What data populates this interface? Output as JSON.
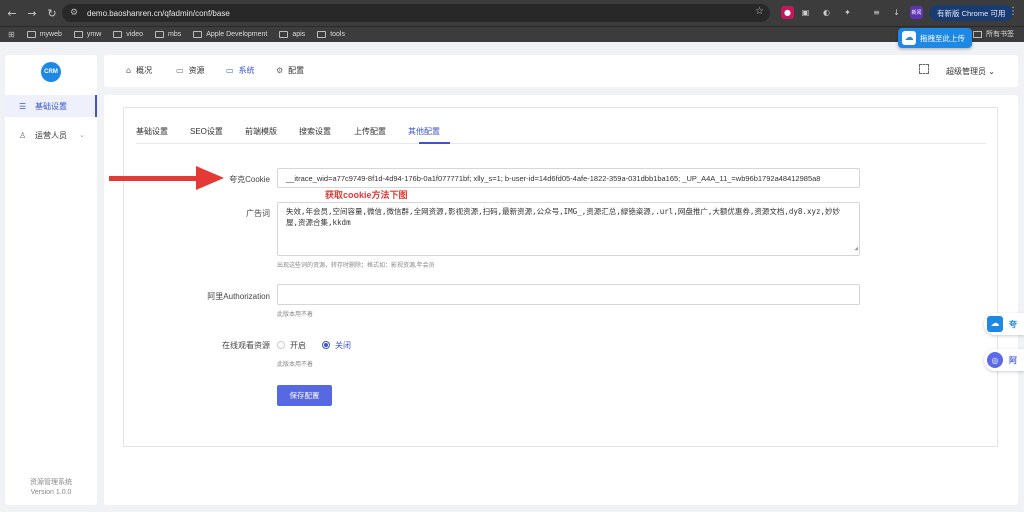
{
  "browser": {
    "url": "demo.baoshanren.cn/qfadmin/conf/base",
    "update_button": "有新版 Chrome 可用",
    "bookmarks": [
      "myweb",
      "ymw",
      "video",
      "mbs",
      "Apple Development",
      "apis",
      "tools"
    ],
    "all_bookmarks": "所有书签",
    "ext_label": "新闻"
  },
  "upload_badge": "拖拽至此上传",
  "sidebar": {
    "logo_text": "CRM",
    "items": [
      {
        "label": "基础设置",
        "icon": "sliders-icon"
      },
      {
        "label": "运营人员",
        "icon": "user-icon"
      }
    ],
    "system_name": "资源管理系统",
    "version": "Version 1.0.0"
  },
  "header": {
    "menu": [
      {
        "label": "概况",
        "icon": "home-icon"
      },
      {
        "label": "资源",
        "icon": "briefcase-icon"
      },
      {
        "label": "系统",
        "icon": "monitor-icon"
      },
      {
        "label": "配置",
        "icon": "gear-icon"
      }
    ],
    "user": "超级管理员"
  },
  "tabs": [
    "基础设置",
    "SEO设置",
    "前端模版",
    "搜索设置",
    "上传配置",
    "其他配置"
  ],
  "form": {
    "cookie_label": "夸克Cookie",
    "cookie_value": "__itrace_wid=a77c9749-8f1d-4d94-176b-0a1f077771bf; xlly_s=1; b-user-id=14d6fd05-4afe-1822-359a-031dbb1ba165; _UP_A4A_11_=wb96b1792a48412985a8",
    "cookie_note": "获取cookie方法下图",
    "ad_label": "广告词",
    "ad_value": "失效,年会员,空间容量,微信,微信群,全网资源,影视资源,扫码,最新资源,公众号,IMG_,资源汇总,緑铯粢源,.url,网盘推广,大额优惠券,资源文档,dy8.xyz,妙妙屋,资源合集,kkdm",
    "ad_hint": "出现这些词的资源，转存时删除；格式如：影视资源,年会员",
    "aliyun_label": "阿里Authorization",
    "aliyun_value": "",
    "aliyun_hint": "此版本用不着",
    "online_label": "在线观看资源",
    "online_options": [
      "开启",
      "关闭"
    ],
    "online_hint": "此版本用不着",
    "save_button": "保存配置"
  },
  "floating": [
    "夸",
    "阿"
  ]
}
